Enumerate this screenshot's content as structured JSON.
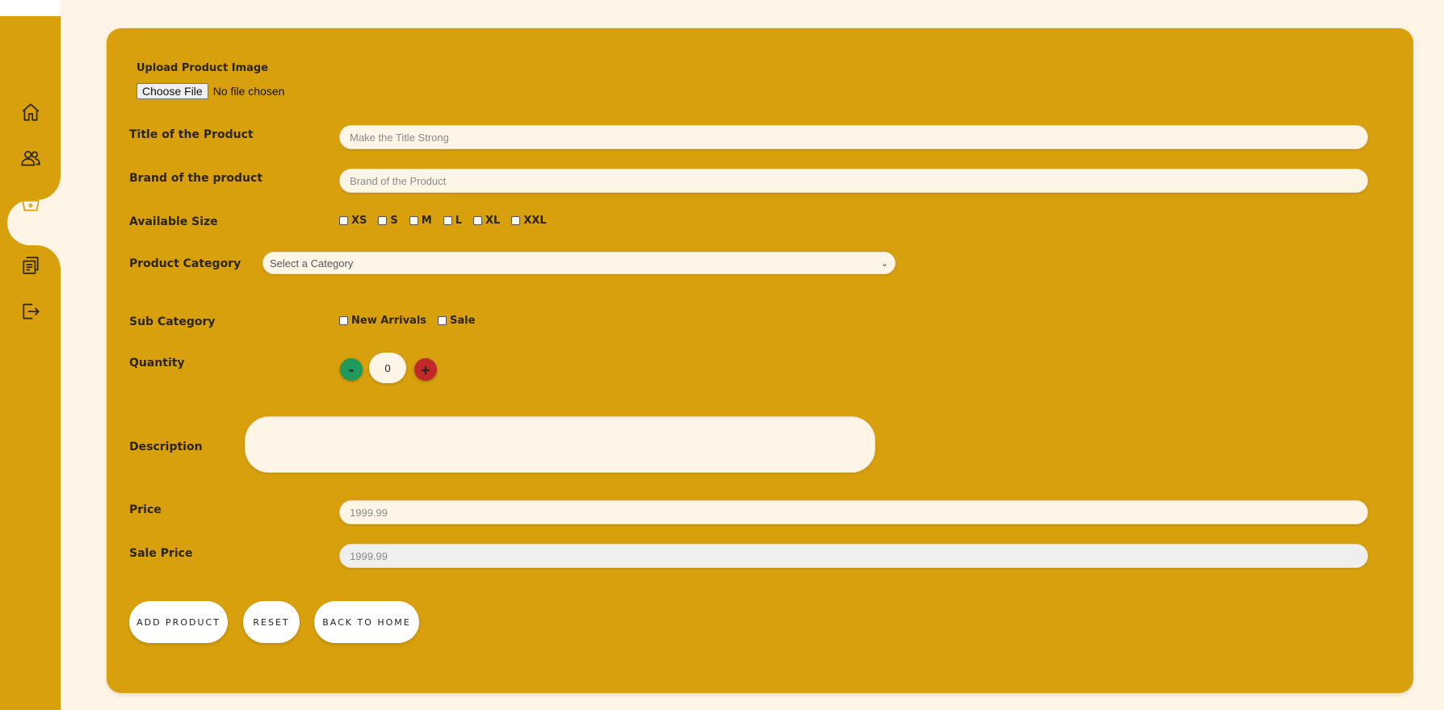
{
  "sidebar": {
    "items": [
      {
        "icon": "home-icon"
      },
      {
        "icon": "users-icon"
      },
      {
        "icon": "basket-icon",
        "active": true
      },
      {
        "icon": "receipt-icon"
      },
      {
        "icon": "logout-icon"
      }
    ],
    "active_color": "#d9a00e"
  },
  "form": {
    "upload_label": "Upload Product Image",
    "file_button": "Choose File",
    "file_status": "No file chosen",
    "title_label": "Title of the Product",
    "title_placeholder": "Make the Title Strong",
    "brand_label": "Brand of the product",
    "brand_placeholder": "Brand of the Product",
    "size_label": "Available Size",
    "sizes": [
      "XS",
      "S",
      "M",
      "L",
      "XL",
      "XXL"
    ],
    "category_label": "Product Category",
    "category_selected": "Select a Category",
    "subcategory_label": "Sub Category",
    "subcategories": [
      "New Arrivals",
      "Sale"
    ],
    "quantity_label": "Quantity",
    "quantity_minus": "-",
    "quantity_value": "0",
    "quantity_plus": "+",
    "description_label": "Description",
    "price_label": "Price",
    "price_placeholder": "1999.99",
    "sale_price_label": "Sale Price",
    "sale_price_placeholder": "1999.99"
  },
  "buttons": {
    "add": "ADD PRODUCT",
    "reset": "RESET",
    "back": "BACK TO HOME"
  },
  "colors": {
    "background": "#fef5e6",
    "accent": "#d9a00e",
    "minus": "#1f9a5a",
    "plus": "#c0282a"
  }
}
